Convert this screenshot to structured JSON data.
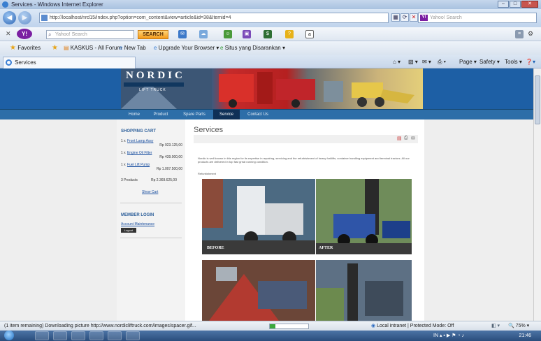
{
  "window": {
    "title": "Services - Windows Internet Explorer"
  },
  "browser": {
    "address": "http://localhost/nrd15/index.php?option=com_content&view=article&id=38&Itemid=4",
    "search_placeholder": "Yahoo! Search",
    "toolbar_search_placeholder": "Yahoo! Search",
    "search_button": "SEARCH",
    "favorites": {
      "label": "Favorites",
      "items": [
        "KASKUS - All Forum",
        "New Tab",
        "Upgrade Your Browser ▾",
        "Situs yang Disarankan ▾"
      ]
    },
    "tab_label": "Services",
    "commands": [
      "Page ▾",
      "Safety ▾",
      "Tools ▾"
    ]
  },
  "site": {
    "logo": {
      "word": "NORDIC",
      "sub": "LIFT TRUCK"
    },
    "nav": [
      "Home",
      "Product",
      "Spare Parts",
      "Service",
      "Contact Us"
    ],
    "active_nav": "Service",
    "cart": {
      "title": "SHOPPING CART",
      "items": [
        {
          "qty": "1 x",
          "name": "Front Lamp Assy",
          "price": "Rp 923.125,00"
        },
        {
          "qty": "1 x",
          "name": "Engine Oil Filter",
          "price": "Rp 439.000,00"
        },
        {
          "qty": "1 x",
          "name": "Fuel Lift Pump",
          "price": "Rp 1.007.500,00"
        }
      ],
      "summary_count": "3 Products",
      "summary_total": "Rp 2.369.625,00",
      "show_cart": "Show Cart"
    },
    "login": {
      "title": "MEMBER LOGIN",
      "link": "Account Maintenance",
      "button": "Logout"
    },
    "page_title": "Services",
    "body_text": "Nordic is well known in this region for its expertise in repairing, servicing and the refurbishment of heavy forklifts, container handling equipment and terminal tractors. All our products are delivered in top fast great running condition.",
    "subheading": "Refurbishment",
    "captions": [
      "BEFORE",
      "AFTER"
    ]
  },
  "statusbar": {
    "text": "(1 item remaining) Downloading picture http://www.nordicliftruck.com/images/spacer.gif...",
    "zone": "Local intranet | Protected Mode: Off",
    "zoom": "75%",
    "progress": 0.15
  },
  "taskbar": {
    "clock": "21:46"
  }
}
